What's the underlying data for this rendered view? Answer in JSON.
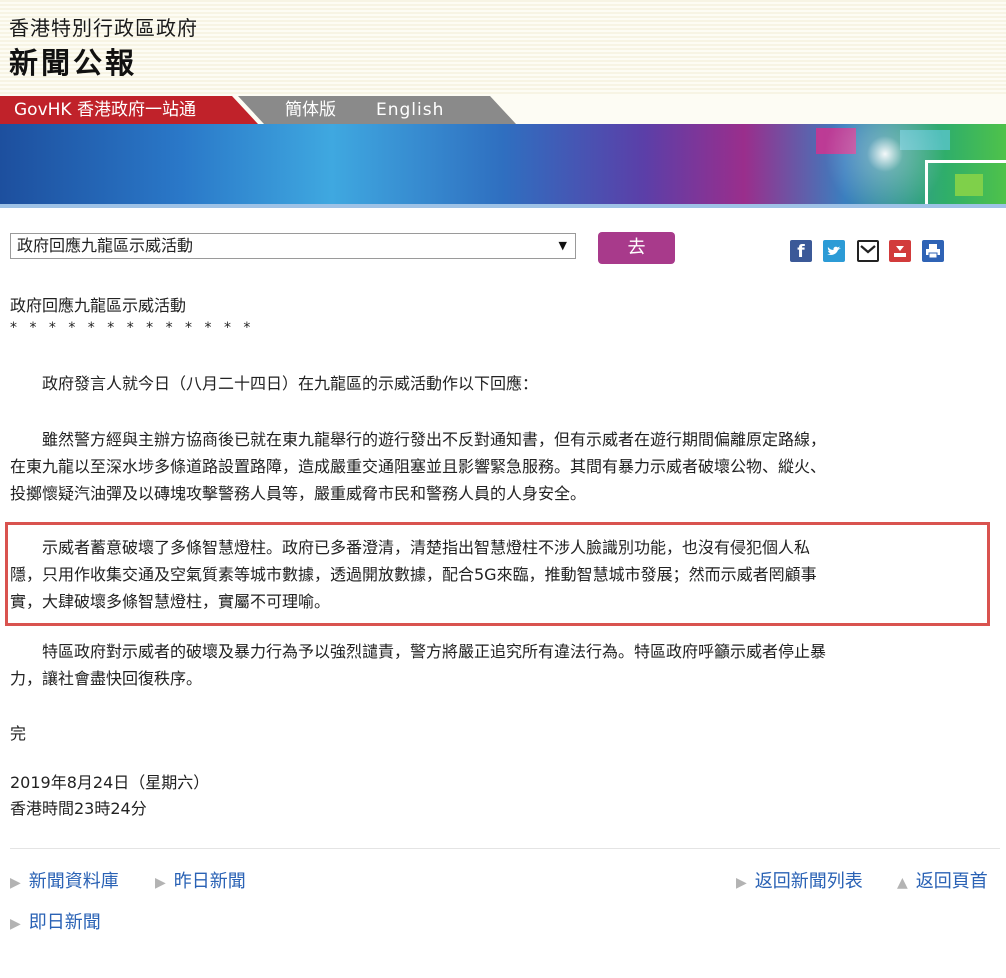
{
  "header": {
    "org_name": "香港特別行政區政府",
    "site_title": "新聞公報"
  },
  "nav": {
    "govhk": "GovHK 香港政府一站通",
    "simplified": "簡体版",
    "english": "English"
  },
  "toolbar": {
    "select_value": "政府回應九龍區示威活動",
    "go_label": "去",
    "share_icons": [
      "facebook-icon",
      "twitter-icon",
      "email-icon",
      "bookmark-icon",
      "print-icon"
    ]
  },
  "article": {
    "title": "政府回應九龍區示威活動",
    "stars": "* * * * * * * * * * * * *",
    "lines": [
      "　　政府發言人就今日（八月二十四日）在九龍區的示威活動作以下回應：",
      "　　雖然警方經與主辦方協商後已就在東九龍舉行的遊行發出不反對通知書，但有示威者在遊行期間偏離原定路線，",
      "在東九龍以至深水埗多條道路設置路障，造成嚴重交通阻塞並且影響緊急服務。其間有暴力示威者破壞公物、縱火、",
      "投擲懷疑汽油彈及以磚塊攻擊警務人員等，嚴重威脅市民和警務人員的人身安全。",
      "　　示威者蓄意破壞了多條智慧燈柱。政府已多番澄清，清楚指出智慧燈柱不涉人臉識別功能，也沒有侵犯個人私",
      "隱，只用作收集交通及空氣質素等城市數據，透過開放數據，配合5G來臨，推動智慧城市發展；然而示威者罔顧事",
      "實，大肆破壞多條智慧燈柱，實屬不可理喻。",
      "　　特區政府對示威者的破壞及暴力行為予以強烈譴責，警方將嚴正追究所有違法行為。特區政府呼籲示威者停止暴",
      "力，讓社會盡快回復秩序。"
    ],
    "end": "完",
    "date": "2019年8月24日（星期六）",
    "time": "香港時間23時24分"
  },
  "footer": {
    "news_archive": "新聞資料庫",
    "yesterday_news": "昨日新聞",
    "back_to_list": "返回新聞列表",
    "back_to_top": "返回頁首",
    "today_news": "即日新聞"
  },
  "colors": {
    "govhk_red": "#c0222a",
    "go_button": "#a83a8b",
    "highlight_border": "#d9534f",
    "link_blue": "#2a62b5"
  }
}
